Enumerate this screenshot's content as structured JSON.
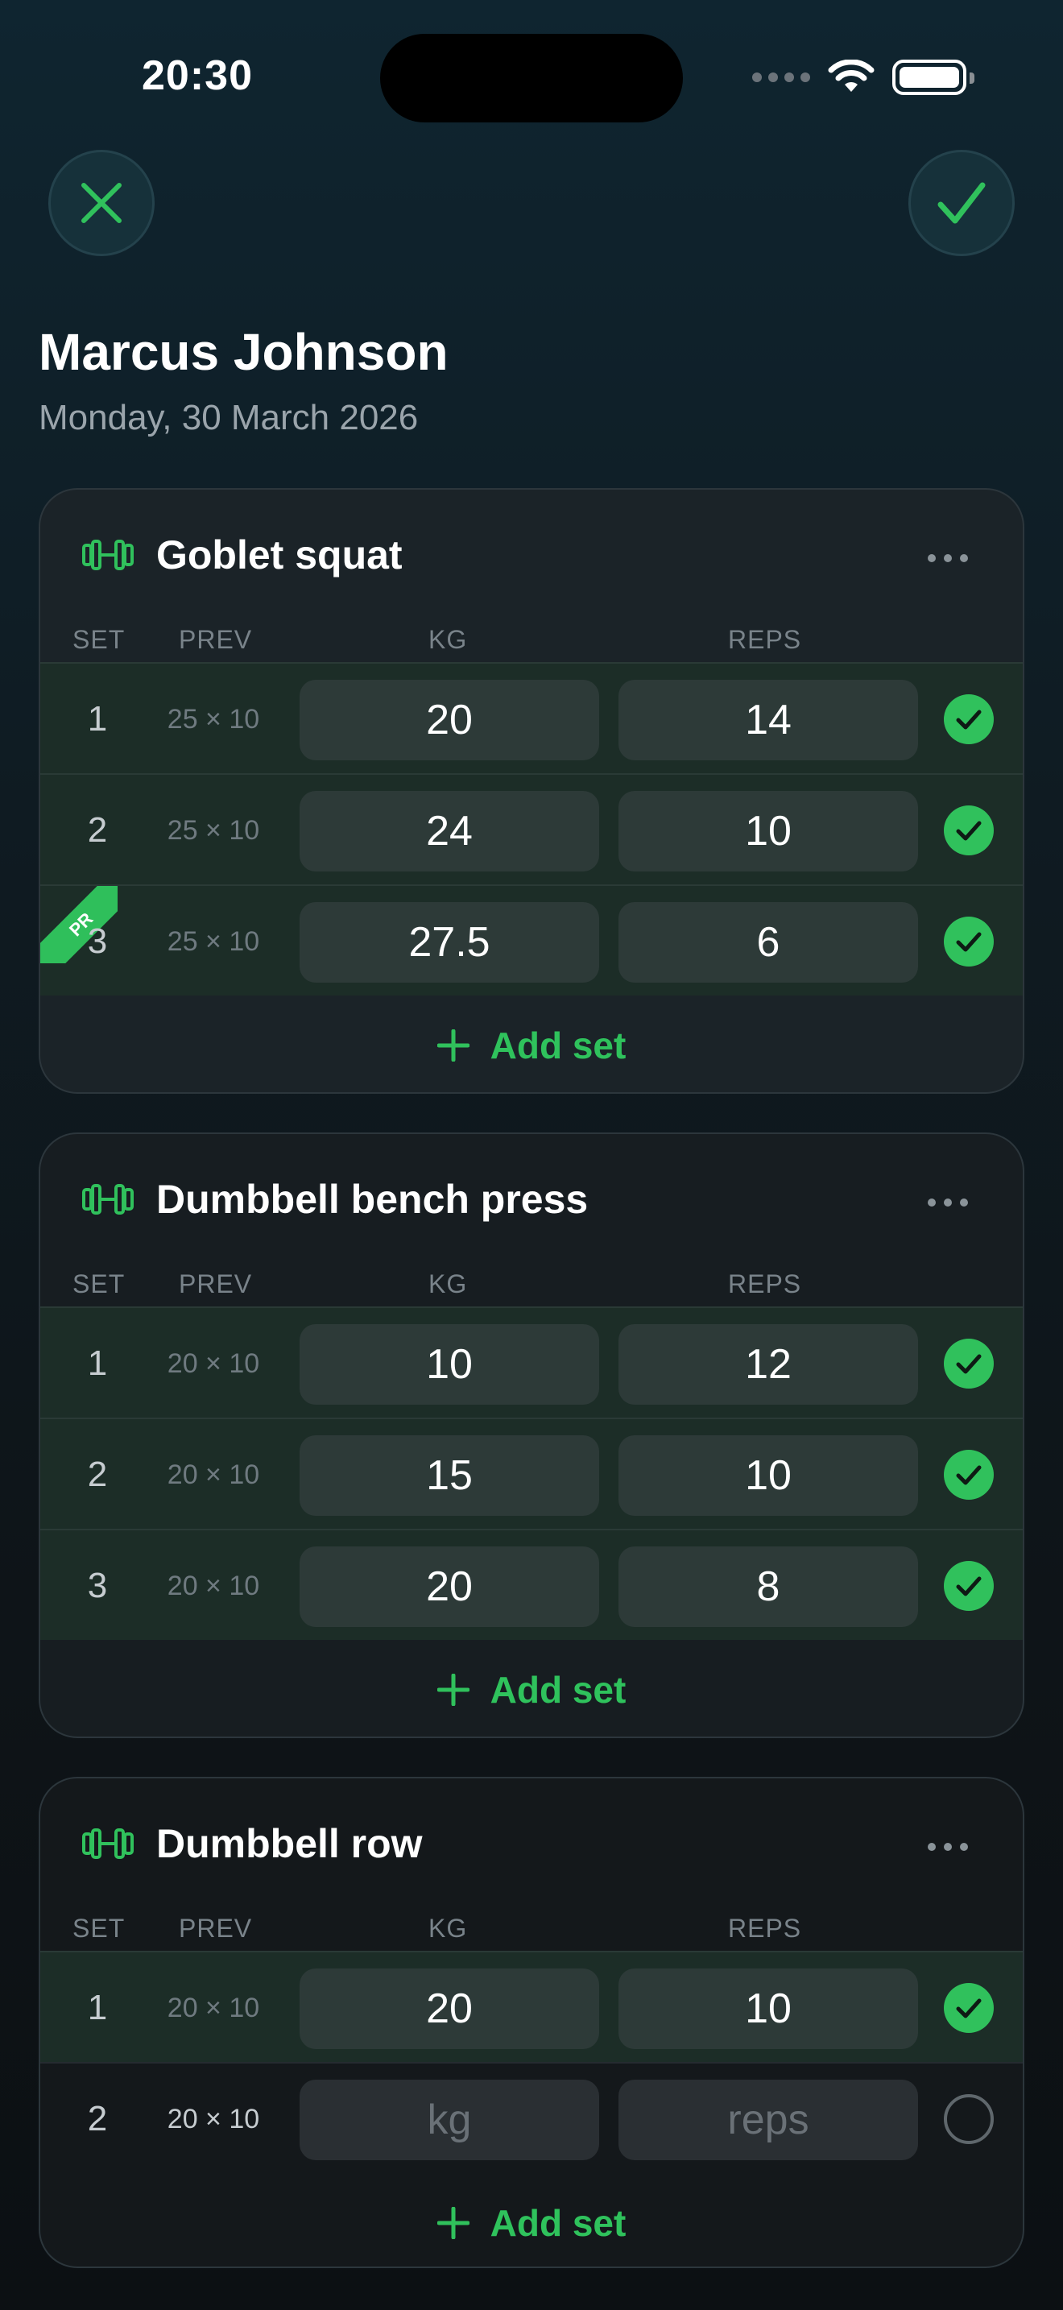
{
  "status": {
    "time": "20:30"
  },
  "header": {
    "title": "Marcus Johnson",
    "date": "Monday, 30 March 2026"
  },
  "columns": {
    "set": "SET",
    "prev": "PREV",
    "kg": "KG",
    "reps": "REPS"
  },
  "icons": {
    "close": "close-icon",
    "done": "checkmark-icon",
    "exercise": "dumbbell-icon",
    "more": "more-horizontal-icon"
  },
  "colors": {
    "accent": "#30c15c",
    "background": "#0f1b22",
    "card": "#1b2328"
  },
  "add_set_label": "Add set",
  "pr_label": "PR",
  "exercises": [
    {
      "name": "Goblet squat",
      "sets": [
        {
          "set": "1",
          "prev": "25 × 10",
          "kg": "20",
          "reps": "14",
          "done": true
        },
        {
          "set": "2",
          "prev": "25 × 10",
          "kg": "24",
          "reps": "10",
          "done": true
        },
        {
          "set": "3",
          "prev": "25 × 10",
          "kg": "27.5",
          "reps": "6",
          "done": true,
          "pr": true
        }
      ]
    },
    {
      "name": "Dumbbell bench press",
      "sets": [
        {
          "set": "1",
          "prev": "20 × 10",
          "kg": "10",
          "reps": "12",
          "done": true
        },
        {
          "set": "2",
          "prev": "20 × 10",
          "kg": "15",
          "reps": "10",
          "done": true
        },
        {
          "set": "3",
          "prev": "20 × 10",
          "kg": "20",
          "reps": "8",
          "done": true
        }
      ]
    },
    {
      "name": "Dumbbell row",
      "sets": [
        {
          "set": "1",
          "prev": "20 × 10",
          "kg": "20",
          "reps": "10",
          "done": true
        },
        {
          "set": "2",
          "prev": "20 × 10",
          "kg_placeholder": "kg",
          "reps_placeholder": "reps",
          "done": false
        }
      ]
    }
  ]
}
